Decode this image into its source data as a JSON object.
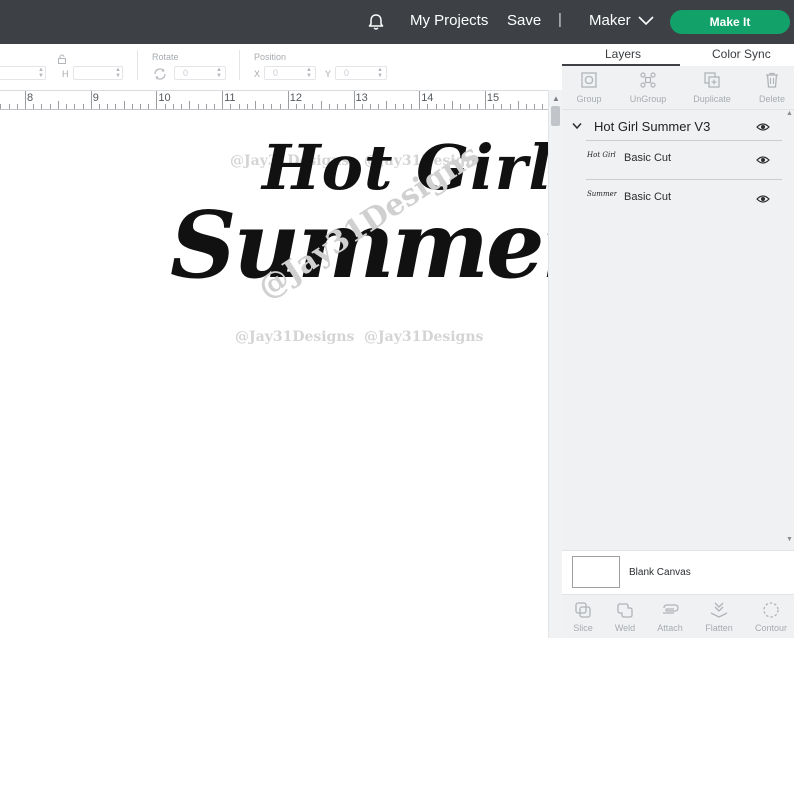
{
  "topbar": {
    "notifications_icon": "bell-icon",
    "my_projects": "My Projects",
    "save": "Save",
    "separator": "|",
    "machine": "Maker",
    "make_it": "Make It"
  },
  "toolbar": {
    "h_label": "H",
    "h_value": "",
    "rotate_label": "Rotate",
    "rotate_value": "0",
    "position_label": "Position",
    "x_label": "X",
    "x_value": "0",
    "y_label": "Y",
    "y_value": "0"
  },
  "ruler": {
    "marks": [
      "8",
      "9",
      "10",
      "11",
      "12",
      "13",
      "14",
      "15"
    ]
  },
  "canvas": {
    "design_line1": "Hot Girl",
    "design_line2": "Summer",
    "watermark": "@Jay31Designs"
  },
  "panel": {
    "tabs": [
      "Layers",
      "Color Sync"
    ],
    "active_tab": "Layers",
    "layer_actions": [
      "Group",
      "UnGroup",
      "Duplicate",
      "Delete"
    ],
    "group_name": "Hot Girl Summer V3",
    "layers": [
      {
        "thumb": "Hot Girl",
        "name": "Basic Cut"
      },
      {
        "thumb": "Summer",
        "name": "Basic Cut"
      }
    ],
    "blank_canvas": "Blank Canvas",
    "bottom_actions": [
      "Slice",
      "Weld",
      "Attach",
      "Flatten",
      "Contour"
    ]
  },
  "colors": {
    "topbar_bg": "#3d4146",
    "make_it": "#13a16a",
    "panel_bg": "#f0f1f2",
    "watermark": "#d4d4d4"
  }
}
